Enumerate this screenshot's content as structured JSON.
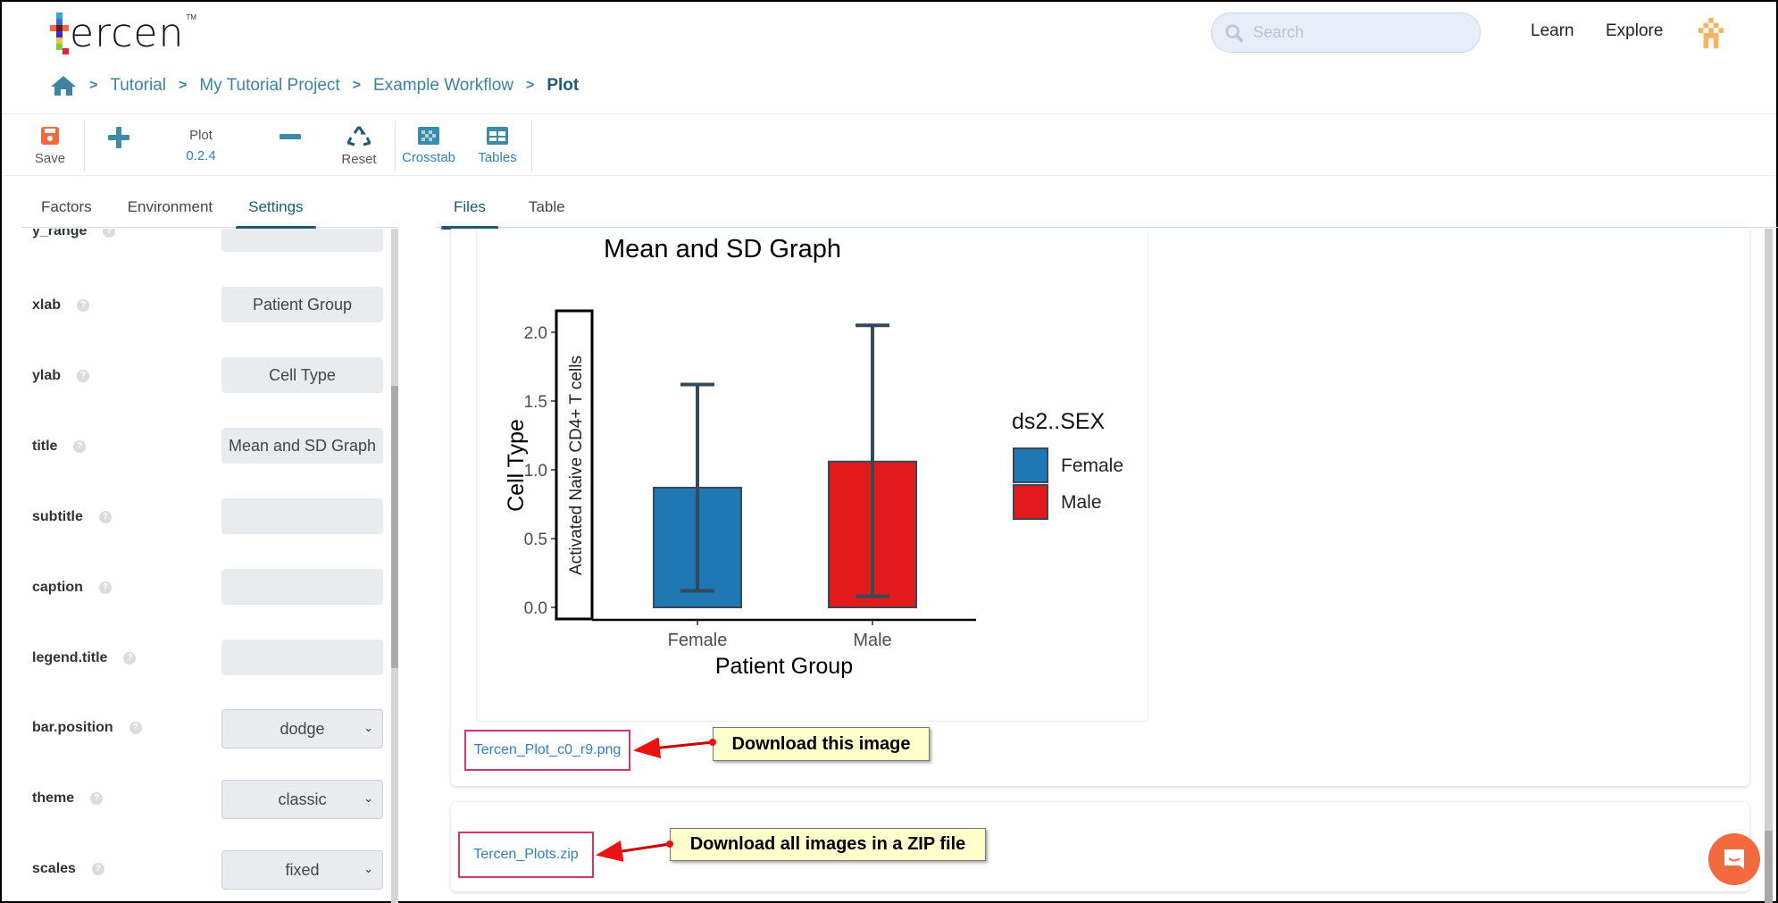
{
  "header": {
    "logo_text": "ercen",
    "logo_tm": "TM",
    "search_placeholder": "Search",
    "nav": [
      {
        "label": "Learn"
      },
      {
        "label": "Explore"
      }
    ],
    "user_icon": "user-avatar-icon"
  },
  "breadcrumb": {
    "home_icon": "home-icon",
    "items": [
      {
        "label": "Tutorial"
      },
      {
        "label": "My Tutorial Project"
      },
      {
        "label": "Example Workflow"
      },
      {
        "label": "Plot"
      }
    ],
    "separator": ">"
  },
  "toolbar": {
    "save_label": "Save",
    "operator_name": "Plot",
    "operator_version": "0.2.4",
    "reset_label": "Reset",
    "crosstab_label": "Crosstab",
    "tables_label": "Tables",
    "colors": {
      "save": "#f26a3d",
      "accent": "#3e8ba8",
      "link": "#2f7fc1"
    }
  },
  "left_tabs": [
    {
      "label": "Factors",
      "active": false
    },
    {
      "label": "Environment",
      "active": false
    },
    {
      "label": "Settings",
      "active": true
    }
  ],
  "right_tabs": [
    {
      "label": "Files",
      "active": true
    },
    {
      "label": "Table",
      "active": false
    }
  ],
  "settings": [
    {
      "name": "y_range",
      "type": "text",
      "value": ""
    },
    {
      "name": "xlab",
      "type": "text",
      "value": "Patient Group"
    },
    {
      "name": "ylab",
      "type": "text",
      "value": "Cell Type"
    },
    {
      "name": "title",
      "type": "text",
      "value": "Mean and SD Graph"
    },
    {
      "name": "subtitle",
      "type": "text",
      "value": ""
    },
    {
      "name": "caption",
      "type": "text",
      "value": ""
    },
    {
      "name": "legend.title",
      "type": "text",
      "value": ""
    },
    {
      "name": "bar.position",
      "type": "select",
      "value": "dodge"
    },
    {
      "name": "theme",
      "type": "select",
      "value": "classic"
    },
    {
      "name": "scales",
      "type": "select",
      "value": "fixed"
    }
  ],
  "files": {
    "image_file": "Tercen_Plot_c0_r9.png",
    "zip_file": "Tercen_Plots.zip"
  },
  "annotations": {
    "image_callout": "Download this image",
    "zip_callout": "Download all images in a ZIP file"
  },
  "chart_data": {
    "type": "bar",
    "title": "Mean and SD Graph",
    "xlabel": "Patient Group",
    "ylabel": "Cell Type",
    "facet_label": "Activated Naive CD4+ T cells",
    "categories": [
      "Female",
      "Male"
    ],
    "values": [
      0.87,
      1.06
    ],
    "error_bars": [
      {
        "low": 0.12,
        "high": 1.62
      },
      {
        "low": 0.08,
        "high": 2.05
      }
    ],
    "colors": [
      "#1f78b4",
      "#e31a1c"
    ],
    "ylim": [
      -0.09,
      2.16
    ],
    "yticks": [
      "0.0",
      "0.5",
      "1.0",
      "1.5",
      "2.0"
    ],
    "ytick_values": [
      0,
      0.5,
      1.0,
      1.5,
      2.0
    ],
    "legend": {
      "title": "ds2..SEX",
      "entries": [
        "Female",
        "Male"
      ],
      "placement": "right"
    },
    "grid": false
  }
}
